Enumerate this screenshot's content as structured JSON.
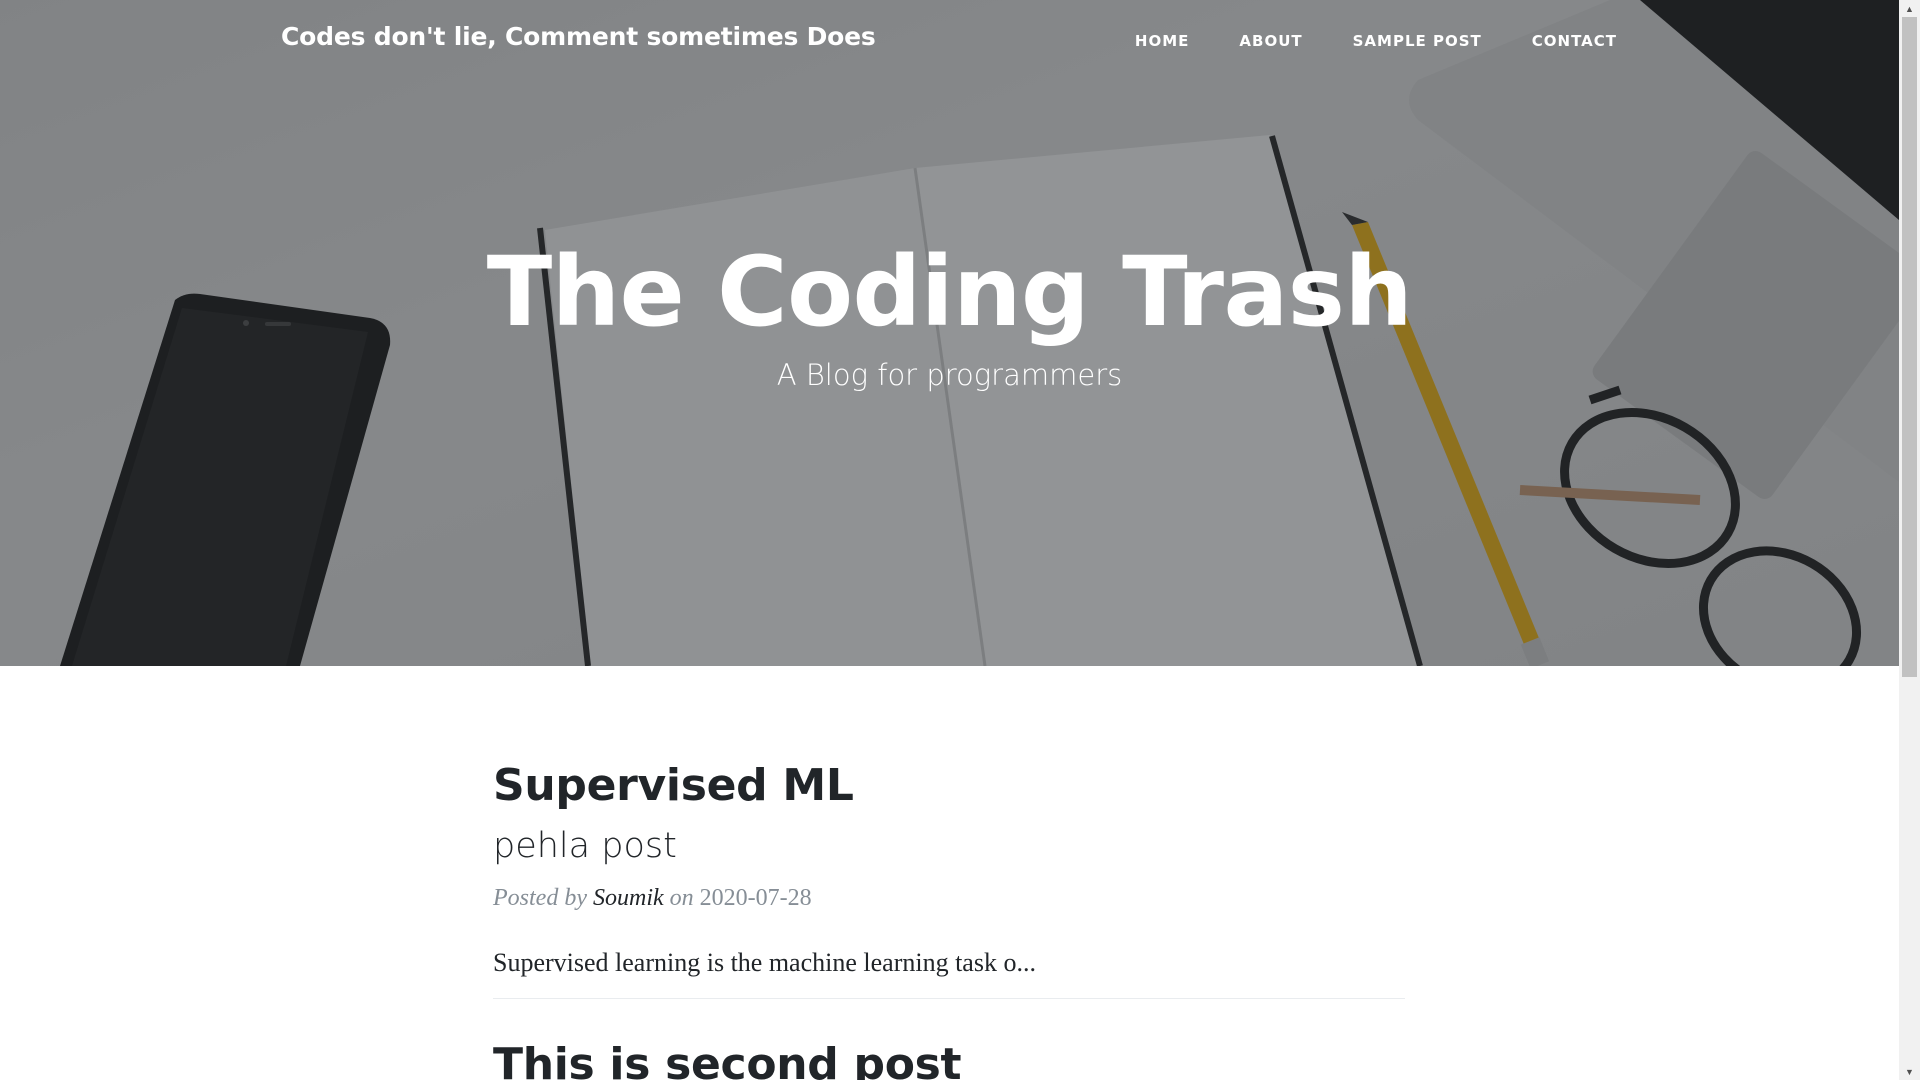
{
  "navbar": {
    "brand": "Codes don't lie, Comment sometimes Does",
    "links": [
      "HOME",
      "ABOUT",
      "SAMPLE POST",
      "CONTACT"
    ]
  },
  "hero": {
    "title": "The Coding Trash",
    "subtitle": "A Blog for programmers"
  },
  "posts": [
    {
      "title": "Supervised ML",
      "subtitle": "pehla post",
      "meta_prefix": "Posted by",
      "author": "Soumik",
      "meta_on": "on",
      "date": "2020-07-28",
      "excerpt": "Supervised learning is the machine learning task o..."
    },
    {
      "title": "This is second post"
    }
  ],
  "colors": {
    "overlay": "#212529",
    "text_dark": "#212529",
    "meta_gray": "#868e96",
    "divider": "#e9ecef"
  }
}
